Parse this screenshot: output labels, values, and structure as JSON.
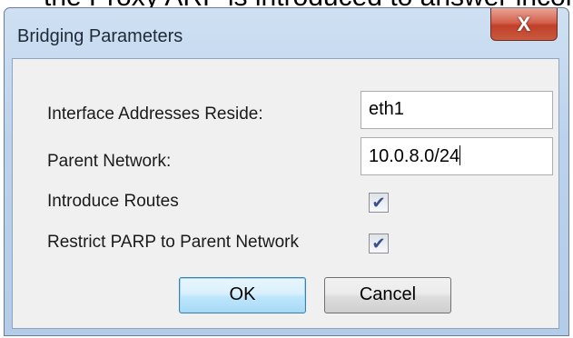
{
  "background": {
    "text": "the Proxy ARP is introduced to answer incom"
  },
  "dialog": {
    "title": "Bridging Parameters",
    "close_label": "X"
  },
  "fields": {
    "interface_label": "Interface Addresses Reside:",
    "interface_value": "eth1",
    "parent_label": "Parent Network:",
    "parent_value": "10.0.8.0/24",
    "introduce_routes_label": "Introduce Routes",
    "introduce_routes_checked": true,
    "restrict_parp_label": "Restrict PARP to Parent Network",
    "restrict_parp_checked": true
  },
  "buttons": {
    "ok": "OK",
    "cancel": "Cancel"
  },
  "icons": {
    "checkmark": "✔",
    "close": "close-icon"
  }
}
